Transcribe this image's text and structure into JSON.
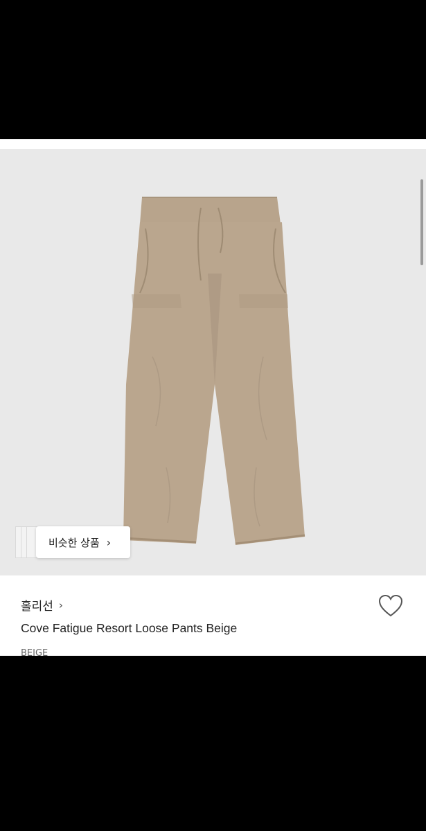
{
  "gallery": {
    "image_description_icon": "pants-photo",
    "similar_button_label": "비슷한 상품",
    "similar_button_chevron": "›"
  },
  "product": {
    "brand": "홀리선",
    "brand_chevron": "›",
    "name": "Cove Fatigue Resort Loose Pants Beige",
    "option_partial": "BEIGE"
  },
  "colors": {
    "gallery_bg": "#e9e9e9",
    "pants": "#b9a58d",
    "text": "#222222"
  }
}
